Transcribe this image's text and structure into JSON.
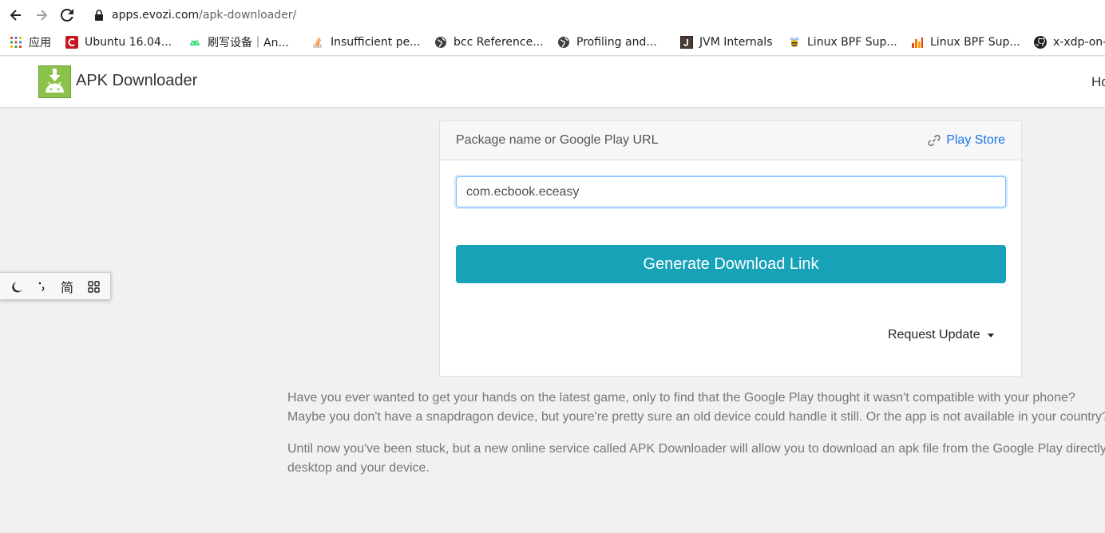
{
  "browser": {
    "url_host": "apps.evozi.com",
    "url_path": "/apk-downloader/",
    "icons": {
      "back": "back-arrow-icon",
      "forward": "forward-arrow-icon",
      "reload": "reload-icon",
      "lock": "lock-icon"
    }
  },
  "bookmarks": [
    {
      "label": "应用",
      "icon": "apps-grid-icon"
    },
    {
      "label": "Ubuntu 16.04...",
      "icon": "red-c-icon"
    },
    {
      "label": "刷写设备｜An...",
      "icon": "android-icon"
    },
    {
      "label": "Insufficient pe...",
      "icon": "stackoverflow-icon"
    },
    {
      "label": "bcc Reference...",
      "icon": "globe-icon"
    },
    {
      "label": "Profiling and...",
      "icon": "globe-icon"
    },
    {
      "label": "JVM Internals",
      "icon": "jvm-icon"
    },
    {
      "label": "Linux BPF Sup...",
      "icon": "bee-icon"
    },
    {
      "label": "Linux BPF Sup...",
      "icon": "chart-icon"
    },
    {
      "label": "x-xdp-on-a",
      "icon": "github-icon"
    }
  ],
  "site": {
    "brand": "APK Downloader",
    "nav_home": "Ho"
  },
  "card": {
    "header_title": "Package name or Google Play URL",
    "play_store_label": "Play Store",
    "input_value": "com.ecbook.eceasy",
    "generate_label": "Generate Download Link",
    "request_update_label": "Request Update"
  },
  "description": {
    "p1_line1": "Have you ever wanted to get your hands on the latest game, only to find that the Google Play thought it wasn't compatible with your phone?",
    "p1_line2": "Maybe you don't have a snapdragon device, but youre're pretty sure an old device could handle it still. Or the app is not available in your country?",
    "p2_line1": "Until now you've been stuck, but a new online service called APK Downloader will allow you to download an apk file from the Google Play directly",
    "p2_line2": "desktop and your device."
  },
  "ime_toolbar": {
    "simplified_label": "简"
  },
  "colors": {
    "accent": "#17a2b8",
    "link": "#1a73e8",
    "logo_green": "#8bc34a",
    "page_bg": "#f1f1f1"
  }
}
